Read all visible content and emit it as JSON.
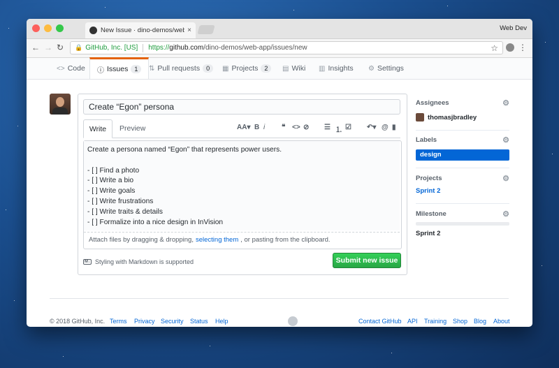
{
  "browser": {
    "tab_title": "New Issue · dino-demos/web-a",
    "tab_close": "×",
    "profile": "Web Dev",
    "secure_label": "GitHub, Inc. [US]",
    "url_https": "https://",
    "url_host": "github.com",
    "url_path": "/dino-demos/web-app/issues/new"
  },
  "repo_nav": [
    {
      "icon": "<>",
      "label": "Code",
      "count": null
    },
    {
      "icon": "ⓘ",
      "label": "Issues",
      "count": "1"
    },
    {
      "icon": "⇅",
      "label": "Pull requests",
      "count": "0"
    },
    {
      "icon": "▦",
      "label": "Projects",
      "count": "2"
    },
    {
      "icon": "▤",
      "label": "Wiki",
      "count": null
    },
    {
      "icon": "▥",
      "label": "Insights",
      "count": null
    },
    {
      "icon": "⚙",
      "label": "Settings",
      "count": null
    }
  ],
  "issue_form": {
    "title_value": "Create “Egon” persona",
    "tab_write": "Write",
    "tab_preview": "Preview",
    "body_lines": [
      "Create a persona named “Egon” that represents power users.",
      "",
      "- [ ] Find a photo",
      "- [ ] Write a bio",
      "- [ ] Write goals",
      "- [ ] Write frustrations",
      "- [ ] Write traits & details",
      "- [ ] Formalize into a nice design in InVision"
    ],
    "attach_before": "Attach files by dragging & dropping,",
    "attach_link": "selecting them",
    "attach_after": ", or pasting from the clipboard.",
    "markdown_note": "Styling with Markdown is supported",
    "submit_label": "Submit new issue"
  },
  "sidebar": {
    "assignees_heading": "Assignees",
    "assignee": "thomasjbradley",
    "labels_heading": "Labels",
    "label": "design",
    "label_color": "#0366d6",
    "projects_heading": "Projects",
    "project": "Sprint 2",
    "milestone_heading": "Milestone",
    "milestone": "Sprint 2"
  },
  "footer": {
    "copyright": "© 2018 GitHub, Inc.",
    "left_links": [
      "Terms",
      "Privacy",
      "Security",
      "Status",
      "Help"
    ],
    "right_links": [
      "Contact GitHub",
      "API",
      "Training",
      "Shop",
      "Blog",
      "About"
    ]
  }
}
